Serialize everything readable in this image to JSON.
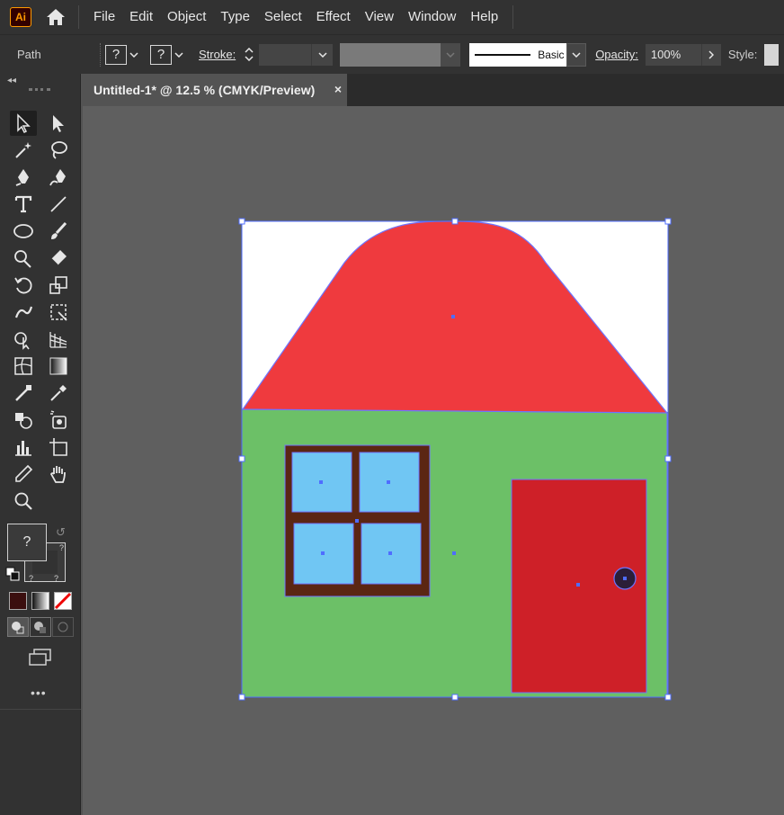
{
  "app": {
    "logo_text": "Ai"
  },
  "menu": [
    "File",
    "Edit",
    "Object",
    "Type",
    "Select",
    "Effect",
    "View",
    "Window",
    "Help"
  ],
  "control_bar": {
    "selection_type": "Path",
    "fill_value": "?",
    "stroke_value": "?",
    "stroke_label": "Stroke:",
    "brush_label": "Basic",
    "opacity_label": "Opacity:",
    "opacity_value": "100%",
    "style_label": "Style:"
  },
  "document": {
    "tab_title": "Untitled-1* @ 12.5 % (CMYK/Preview)",
    "close_glyph": "×"
  },
  "tools": {
    "fill_value": "?",
    "stroke_value": "?",
    "small_swatch_value": "?",
    "more_label": "•••"
  },
  "colors": {
    "sky": "#ffffff",
    "roof": "#ef3a3e",
    "wall": "#6cc067",
    "window_frame": "#5b2613",
    "window_glass": "#70c6f3",
    "door": "#ce2028",
    "door_knob": "#2b1e38",
    "selection": "#4f6dff"
  }
}
